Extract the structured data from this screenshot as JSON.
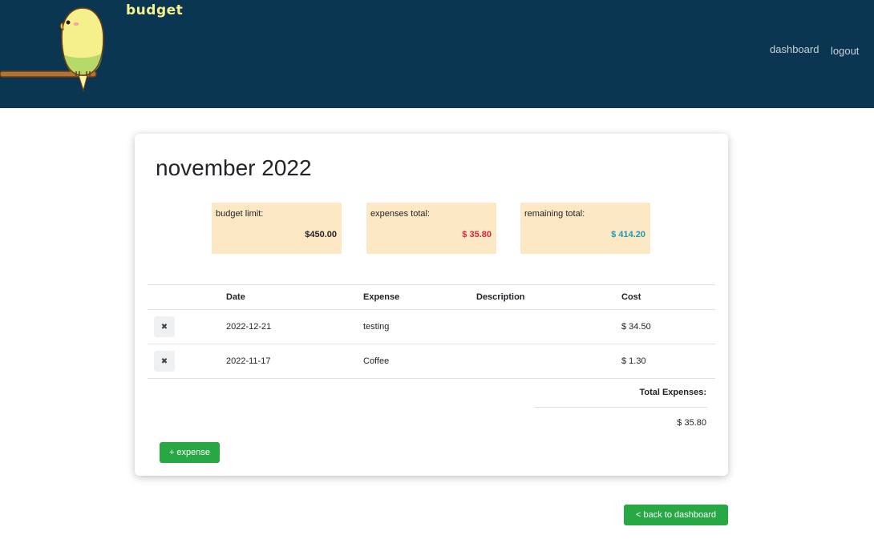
{
  "header": {
    "brand": "budget",
    "nav": {
      "dashboard": "dashboard",
      "logout": "logout"
    }
  },
  "card": {
    "title": "november 2022",
    "stats": [
      {
        "label": "budget limit:",
        "value": "$450.00",
        "color": "#212529"
      },
      {
        "label": "expenses total:",
        "value": "$ 35.80",
        "color": "#d0293b"
      },
      {
        "label": "remaining total:",
        "value": "$ 414.20",
        "color": "#1c9ab4"
      }
    ],
    "table": {
      "headers": [
        "",
        "Date",
        "Expense",
        "Description",
        "Cost"
      ],
      "rows": [
        {
          "date": "2022-12-21",
          "expense": "testing",
          "description": "",
          "cost": "$ 34.50"
        },
        {
          "date": "2022-11-17",
          "expense": "Coffee",
          "description": "",
          "cost": "$ 1.30"
        }
      ]
    },
    "total_label": "Total Expenses:",
    "total_value": "$ 35.80",
    "add_button": "+ expense"
  },
  "back_button": "< back to dashboard",
  "icons": {
    "delete": "close-icon",
    "mascot": "parakeet-logo"
  },
  "colors": {
    "header_bg": "#0a3651",
    "brand": "#f6f08c",
    "stat_bg": "#fde8c6",
    "button": "#28a745"
  }
}
